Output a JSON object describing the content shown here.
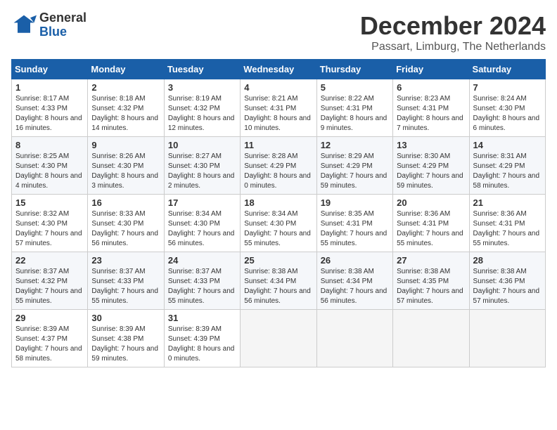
{
  "header": {
    "logo_general": "General",
    "logo_blue": "Blue",
    "month_title": "December 2024",
    "location": "Passart, Limburg, The Netherlands"
  },
  "days_of_week": [
    "Sunday",
    "Monday",
    "Tuesday",
    "Wednesday",
    "Thursday",
    "Friday",
    "Saturday"
  ],
  "weeks": [
    [
      {
        "day": "1",
        "sunrise": "Sunrise: 8:17 AM",
        "sunset": "Sunset: 4:33 PM",
        "daylight": "Daylight: 8 hours and 16 minutes."
      },
      {
        "day": "2",
        "sunrise": "Sunrise: 8:18 AM",
        "sunset": "Sunset: 4:32 PM",
        "daylight": "Daylight: 8 hours and 14 minutes."
      },
      {
        "day": "3",
        "sunrise": "Sunrise: 8:19 AM",
        "sunset": "Sunset: 4:32 PM",
        "daylight": "Daylight: 8 hours and 12 minutes."
      },
      {
        "day": "4",
        "sunrise": "Sunrise: 8:21 AM",
        "sunset": "Sunset: 4:31 PM",
        "daylight": "Daylight: 8 hours and 10 minutes."
      },
      {
        "day": "5",
        "sunrise": "Sunrise: 8:22 AM",
        "sunset": "Sunset: 4:31 PM",
        "daylight": "Daylight: 8 hours and 9 minutes."
      },
      {
        "day": "6",
        "sunrise": "Sunrise: 8:23 AM",
        "sunset": "Sunset: 4:31 PM",
        "daylight": "Daylight: 8 hours and 7 minutes."
      },
      {
        "day": "7",
        "sunrise": "Sunrise: 8:24 AM",
        "sunset": "Sunset: 4:30 PM",
        "daylight": "Daylight: 8 hours and 6 minutes."
      }
    ],
    [
      {
        "day": "8",
        "sunrise": "Sunrise: 8:25 AM",
        "sunset": "Sunset: 4:30 PM",
        "daylight": "Daylight: 8 hours and 4 minutes."
      },
      {
        "day": "9",
        "sunrise": "Sunrise: 8:26 AM",
        "sunset": "Sunset: 4:30 PM",
        "daylight": "Daylight: 8 hours and 3 minutes."
      },
      {
        "day": "10",
        "sunrise": "Sunrise: 8:27 AM",
        "sunset": "Sunset: 4:30 PM",
        "daylight": "Daylight: 8 hours and 2 minutes."
      },
      {
        "day": "11",
        "sunrise": "Sunrise: 8:28 AM",
        "sunset": "Sunset: 4:29 PM",
        "daylight": "Daylight: 8 hours and 0 minutes."
      },
      {
        "day": "12",
        "sunrise": "Sunrise: 8:29 AM",
        "sunset": "Sunset: 4:29 PM",
        "daylight": "Daylight: 7 hours and 59 minutes."
      },
      {
        "day": "13",
        "sunrise": "Sunrise: 8:30 AM",
        "sunset": "Sunset: 4:29 PM",
        "daylight": "Daylight: 7 hours and 59 minutes."
      },
      {
        "day": "14",
        "sunrise": "Sunrise: 8:31 AM",
        "sunset": "Sunset: 4:29 PM",
        "daylight": "Daylight: 7 hours and 58 minutes."
      }
    ],
    [
      {
        "day": "15",
        "sunrise": "Sunrise: 8:32 AM",
        "sunset": "Sunset: 4:30 PM",
        "daylight": "Daylight: 7 hours and 57 minutes."
      },
      {
        "day": "16",
        "sunrise": "Sunrise: 8:33 AM",
        "sunset": "Sunset: 4:30 PM",
        "daylight": "Daylight: 7 hours and 56 minutes."
      },
      {
        "day": "17",
        "sunrise": "Sunrise: 8:34 AM",
        "sunset": "Sunset: 4:30 PM",
        "daylight": "Daylight: 7 hours and 56 minutes."
      },
      {
        "day": "18",
        "sunrise": "Sunrise: 8:34 AM",
        "sunset": "Sunset: 4:30 PM",
        "daylight": "Daylight: 7 hours and 55 minutes."
      },
      {
        "day": "19",
        "sunrise": "Sunrise: 8:35 AM",
        "sunset": "Sunset: 4:31 PM",
        "daylight": "Daylight: 7 hours and 55 minutes."
      },
      {
        "day": "20",
        "sunrise": "Sunrise: 8:36 AM",
        "sunset": "Sunset: 4:31 PM",
        "daylight": "Daylight: 7 hours and 55 minutes."
      },
      {
        "day": "21",
        "sunrise": "Sunrise: 8:36 AM",
        "sunset": "Sunset: 4:31 PM",
        "daylight": "Daylight: 7 hours and 55 minutes."
      }
    ],
    [
      {
        "day": "22",
        "sunrise": "Sunrise: 8:37 AM",
        "sunset": "Sunset: 4:32 PM",
        "daylight": "Daylight: 7 hours and 55 minutes."
      },
      {
        "day": "23",
        "sunrise": "Sunrise: 8:37 AM",
        "sunset": "Sunset: 4:33 PM",
        "daylight": "Daylight: 7 hours and 55 minutes."
      },
      {
        "day": "24",
        "sunrise": "Sunrise: 8:37 AM",
        "sunset": "Sunset: 4:33 PM",
        "daylight": "Daylight: 7 hours and 55 minutes."
      },
      {
        "day": "25",
        "sunrise": "Sunrise: 8:38 AM",
        "sunset": "Sunset: 4:34 PM",
        "daylight": "Daylight: 7 hours and 56 minutes."
      },
      {
        "day": "26",
        "sunrise": "Sunrise: 8:38 AM",
        "sunset": "Sunset: 4:34 PM",
        "daylight": "Daylight: 7 hours and 56 minutes."
      },
      {
        "day": "27",
        "sunrise": "Sunrise: 8:38 AM",
        "sunset": "Sunset: 4:35 PM",
        "daylight": "Daylight: 7 hours and 57 minutes."
      },
      {
        "day": "28",
        "sunrise": "Sunrise: 8:38 AM",
        "sunset": "Sunset: 4:36 PM",
        "daylight": "Daylight: 7 hours and 57 minutes."
      }
    ],
    [
      {
        "day": "29",
        "sunrise": "Sunrise: 8:39 AM",
        "sunset": "Sunset: 4:37 PM",
        "daylight": "Daylight: 7 hours and 58 minutes."
      },
      {
        "day": "30",
        "sunrise": "Sunrise: 8:39 AM",
        "sunset": "Sunset: 4:38 PM",
        "daylight": "Daylight: 7 hours and 59 minutes."
      },
      {
        "day": "31",
        "sunrise": "Sunrise: 8:39 AM",
        "sunset": "Sunset: 4:39 PM",
        "daylight": "Daylight: 8 hours and 0 minutes."
      },
      null,
      null,
      null,
      null
    ]
  ]
}
